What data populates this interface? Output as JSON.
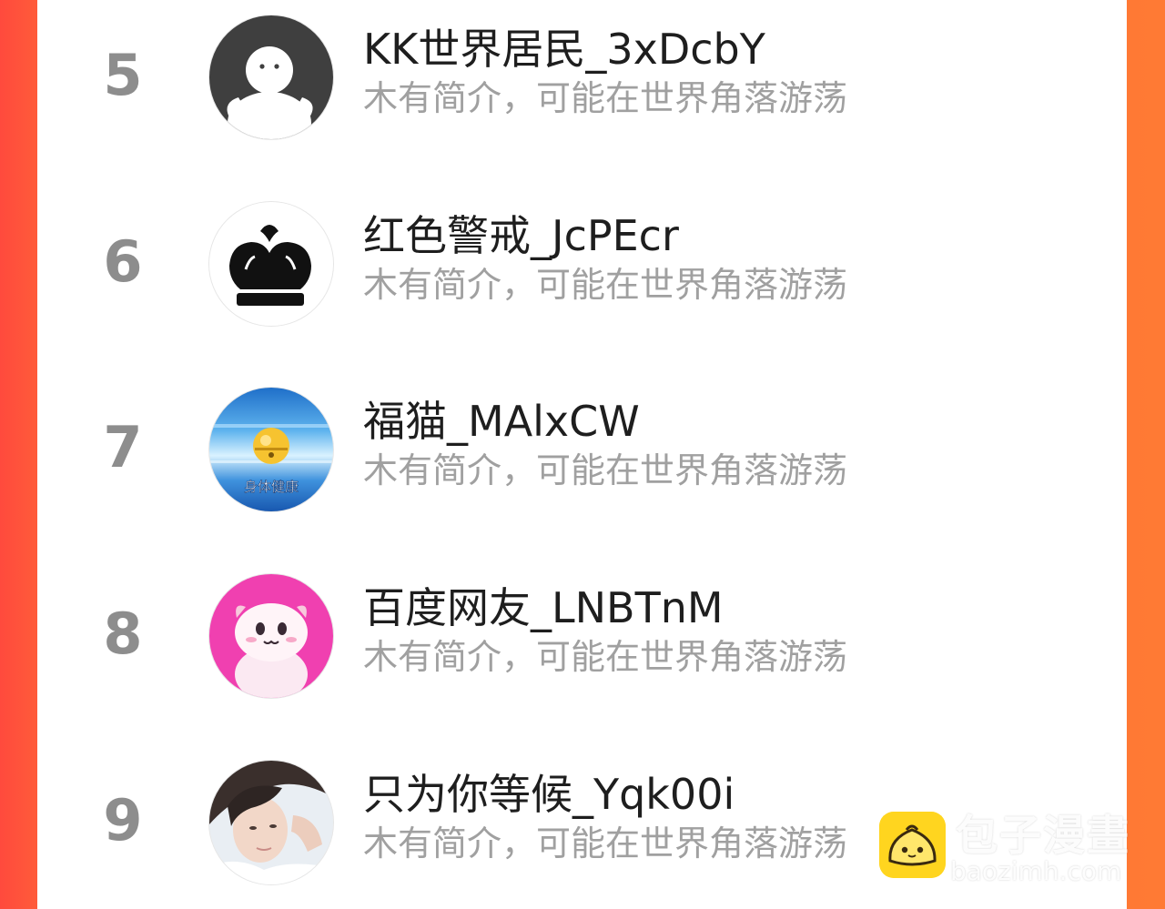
{
  "colors": {
    "background_gradient_left": "#ff4a3d",
    "background_gradient_right": "#ff7a34",
    "panel": "#ffffff",
    "rank_number": "#8d8d8d",
    "user_name": "#1e1e1e",
    "user_bio": "#a0a0a0",
    "watermark_logo": "#ffd51f"
  },
  "ranking": [
    {
      "rank": "5",
      "name": "KK世界居民_3xDcbY",
      "bio": "木有简介，可能在世界角落游荡",
      "avatar_icon": "default-penguin-avatar-icon"
    },
    {
      "rank": "6",
      "name": "红色警戒_JcPEcr",
      "bio": "木有简介，可能在世界角落游荡",
      "avatar_icon": "black-crown-avatar-icon"
    },
    {
      "rank": "7",
      "name": "福猫_MAlxCW",
      "bio": "木有简介，可能在世界角落游荡",
      "avatar_icon": "golden-bell-avatar-icon",
      "avatar_caption": "身体健康"
    },
    {
      "rank": "8",
      "name": "百度网友_LNBTnM",
      "bio": "木有简介，可能在世界角落游荡",
      "avatar_icon": "pink-mascot-avatar-icon"
    },
    {
      "rank": "9",
      "name": "只为你等候_Yqk00i",
      "bio": "木有简介，可能在世界角落游荡",
      "avatar_icon": "photo-portrait-avatar-icon"
    }
  ],
  "watermark": {
    "title": "包子漫畫",
    "url": "baozimh.com",
    "logo_icon": "bun-mascot-icon"
  }
}
